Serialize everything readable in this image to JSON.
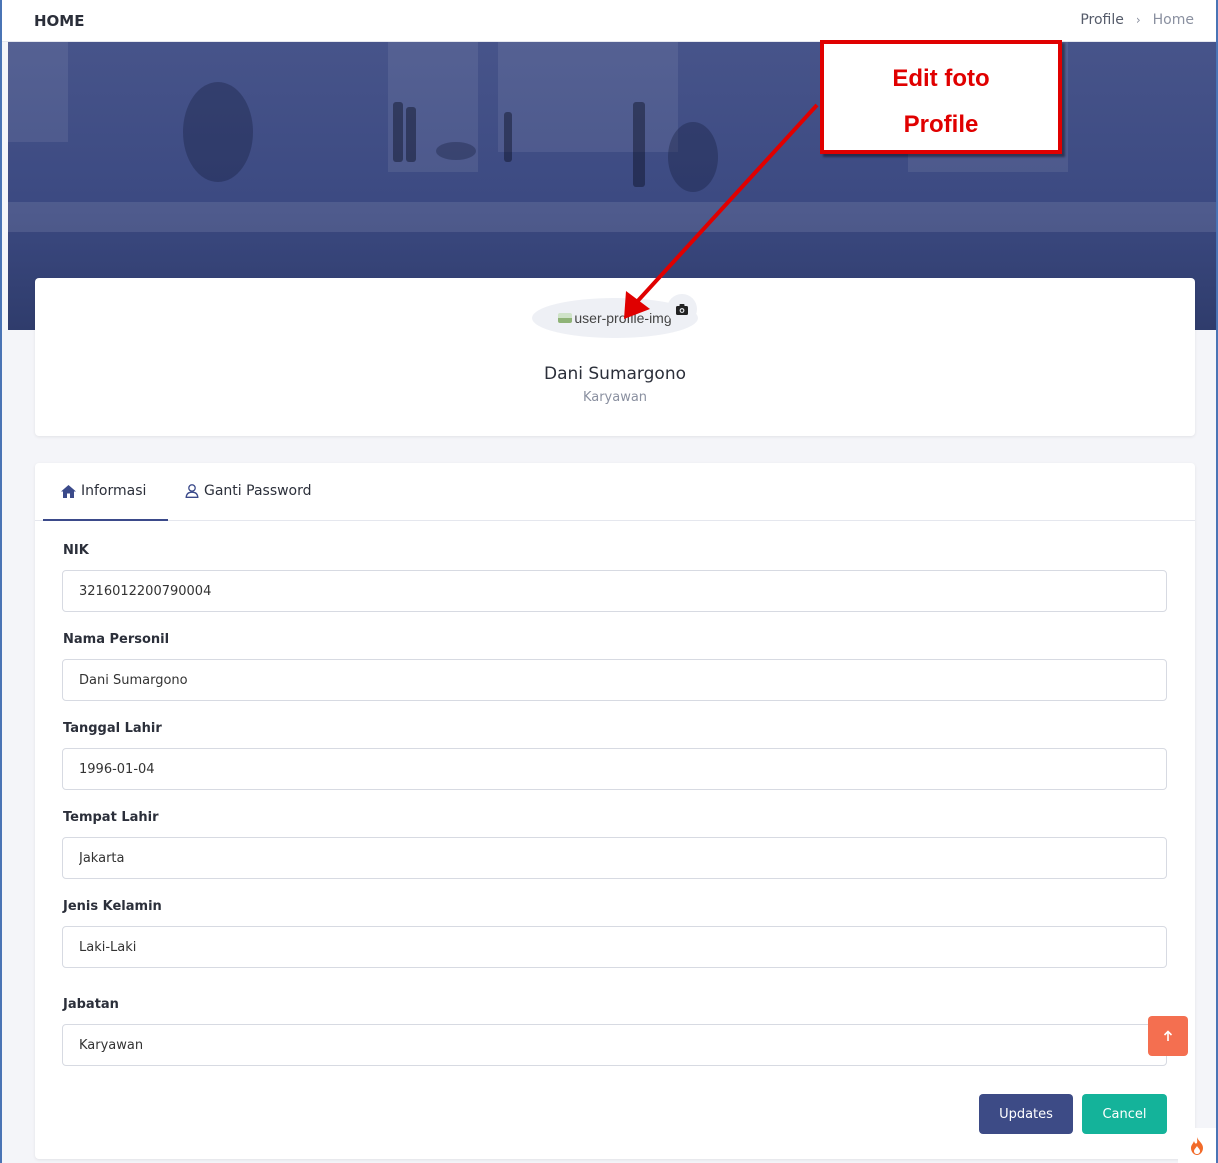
{
  "header": {
    "title": "HOME",
    "breadcrumb": [
      "Profile",
      "Home"
    ],
    "separator": "›"
  },
  "profile": {
    "avatar_alt_text": "user-profile-img",
    "name": "Dani Sumargono",
    "role": "Karyawan"
  },
  "annotation": {
    "line1": "Edit foto",
    "line2": "Profile",
    "color": "#e00000"
  },
  "tabs": [
    {
      "label": "Informasi",
      "icon": "home-icon",
      "active": true
    },
    {
      "label": "Ganti Password",
      "icon": "user-icon",
      "active": false
    }
  ],
  "form": {
    "fields": [
      {
        "label": "NIK",
        "value": "3216012200790004"
      },
      {
        "label": "Nama Personil",
        "value": "Dani Sumargono"
      },
      {
        "label": "Tanggal Lahir",
        "value": "1996-01-04"
      },
      {
        "label": "Tempat Lahir",
        "value": "Jakarta"
      },
      {
        "label": "Jenis Kelamin",
        "value": "Laki-Laki"
      },
      {
        "label": "Jabatan",
        "value": "Karyawan"
      }
    ],
    "update_label": "Updates",
    "cancel_label": "Cancel"
  },
  "colors": {
    "primary": "#3d4b86",
    "success": "#14b39a",
    "scroll_top": "#f46f50"
  }
}
